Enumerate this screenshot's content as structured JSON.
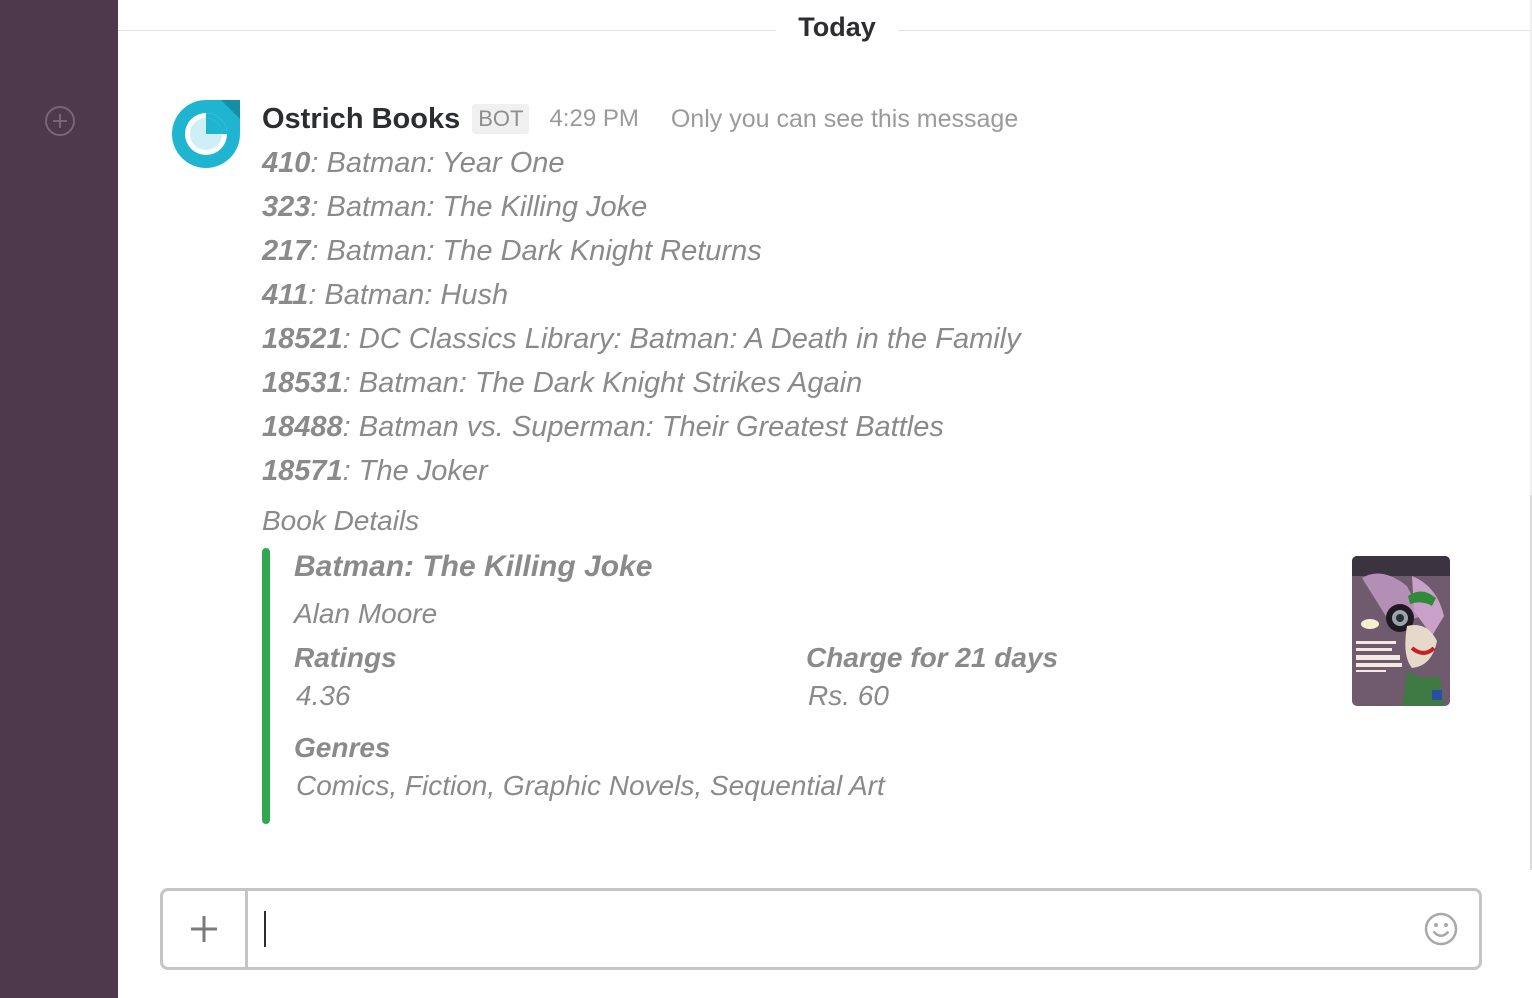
{
  "day_divider": "Today",
  "message": {
    "sender": "Ostrich Books",
    "badge": "BOT",
    "time": "4:29 PM",
    "visibility": "Only you can see this message",
    "books": [
      {
        "id": "410",
        "title": ": Batman: Year One"
      },
      {
        "id": "323",
        "title": ": Batman: The Killing Joke"
      },
      {
        "id": "217",
        "title": ": Batman: The Dark Knight Returns"
      },
      {
        "id": "411",
        "title": ": Batman: Hush"
      },
      {
        "id": "18521",
        "title": ": DC Classics Library: Batman: A Death in the Family"
      },
      {
        "id": "18531",
        "title": ": Batman: The Dark Knight Strikes Again"
      },
      {
        "id": "18488",
        "title": ": Batman vs. Superman: Their Greatest Battles"
      },
      {
        "id": "18571",
        "title": ": The Joker"
      }
    ],
    "details_label": "Book Details"
  },
  "attachment": {
    "title": "Batman: The Killing Joke",
    "author": "Alan Moore",
    "fields": {
      "ratings_label": "Ratings",
      "ratings_value": "4.36",
      "charge_label": "Charge for 21 days",
      "charge_value": "Rs. 60",
      "genres_label": "Genres",
      "genres_value": "Comics, Fiction, Graphic Novels, Sequential Art"
    },
    "accent_color": "#2fa84f"
  },
  "composer": {
    "value": ""
  },
  "colors": {
    "sidebar": "#4d394b",
    "avatar": "#1fb5d1"
  },
  "icons": {
    "sidebar_add": "circle-plus-icon",
    "composer_add": "plus-icon",
    "emoji": "smiley-icon"
  }
}
